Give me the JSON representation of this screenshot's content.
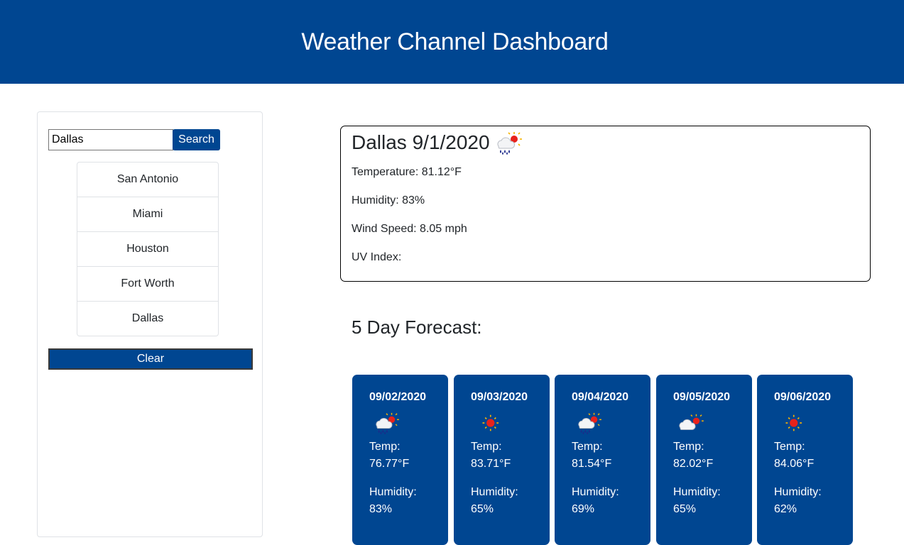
{
  "header": {
    "title": "Weather Channel Dashboard"
  },
  "sidebar": {
    "search_value": "Dallas",
    "search_button_label": "Search",
    "history": [
      {
        "label": "San Antonio"
      },
      {
        "label": "Miami"
      },
      {
        "label": "Houston"
      },
      {
        "label": "Fort Worth"
      },
      {
        "label": "Dallas"
      }
    ],
    "clear_label": "Clear"
  },
  "current": {
    "title": "Dallas 9/1/2020",
    "icon": "rain-sun-icon",
    "temperature": "Temperature: 81.12°F",
    "humidity": "Humidity: 83%",
    "wind": "Wind Speed: 8.05 mph",
    "uv": "UV Index:"
  },
  "forecast": {
    "heading": "5 Day Forecast:",
    "days": [
      {
        "date": "09/02/2020",
        "icon": "rain-sun-icon",
        "temp_label": "Temp:",
        "temp": "76.77°F",
        "humidity_label": "Humidity:",
        "humidity": "83%"
      },
      {
        "date": "09/03/2020",
        "icon": "sun-icon",
        "temp_label": "Temp:",
        "temp": "83.71°F",
        "humidity_label": "Humidity:",
        "humidity": "65%"
      },
      {
        "date": "09/04/2020",
        "icon": "rain-sun-icon",
        "temp_label": "Temp:",
        "temp": "81.54°F",
        "humidity_label": "Humidity:",
        "humidity": "69%"
      },
      {
        "date": "09/05/2020",
        "icon": "cloud-sun-icon",
        "temp_label": "Temp:",
        "temp": "82.02°F",
        "humidity_label": "Humidity:",
        "humidity": "65%"
      },
      {
        "date": "09/06/2020",
        "icon": "sun-icon",
        "temp_label": "Temp:",
        "temp": "84.06°F",
        "humidity_label": "Humidity:",
        "humidity": "62%"
      }
    ]
  },
  "colors": {
    "brand": "#004691",
    "text": "#212529",
    "border": "#dfe2e6"
  }
}
